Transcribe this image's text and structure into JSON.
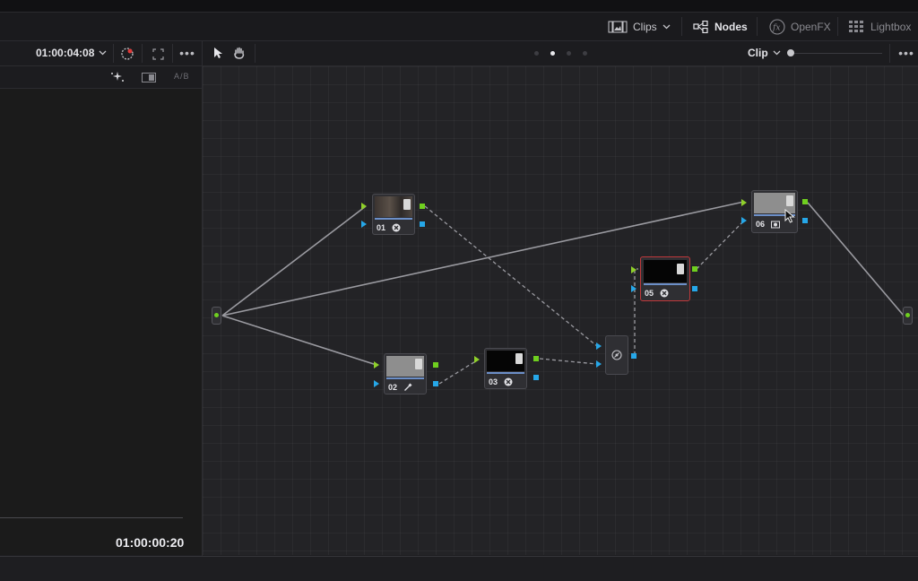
{
  "colors": {
    "accent_green": "#6fcf1f",
    "accent_blue": "#26a7e8",
    "selected_red": "#c0393b",
    "link_line": "#9a9aa0"
  },
  "page_tabs": {
    "clips": {
      "label": "Clips",
      "icon": "clips-icon",
      "caret": "chevron-down-icon"
    },
    "nodes": {
      "label": "Nodes",
      "icon": "nodes-icon"
    },
    "openfx": {
      "label": "OpenFX",
      "icon": "fx-icon"
    },
    "lightbox": {
      "label": "Lightbox",
      "icon": "lightbox-grid-icon"
    }
  },
  "viewer": {
    "timecode": "01:00:04:08",
    "ab_label": "A/B",
    "footer_timecode": "01:00:00:20",
    "more": "•••"
  },
  "node_toolbar": {
    "mode_label": "Clip",
    "more": "•••",
    "page_dots": 4,
    "active_dot": 1
  },
  "nodes": [
    {
      "id": "01",
      "thumb": "photo",
      "icon": "gear-circle-icon",
      "selected": false
    },
    {
      "id": "02",
      "thumb": "gray",
      "icon": "eyedropper-icon",
      "selected": false
    },
    {
      "id": "03",
      "thumb": "black",
      "icon": "gear-circle-icon",
      "selected": false
    },
    {
      "id": "05",
      "thumb": "black",
      "icon": "gear-circle-icon",
      "selected": true
    },
    {
      "id": "06",
      "thumb": "gray",
      "icon": "camera-icon",
      "selected": false
    }
  ],
  "mixer": {
    "icon": "mixer-icon"
  }
}
